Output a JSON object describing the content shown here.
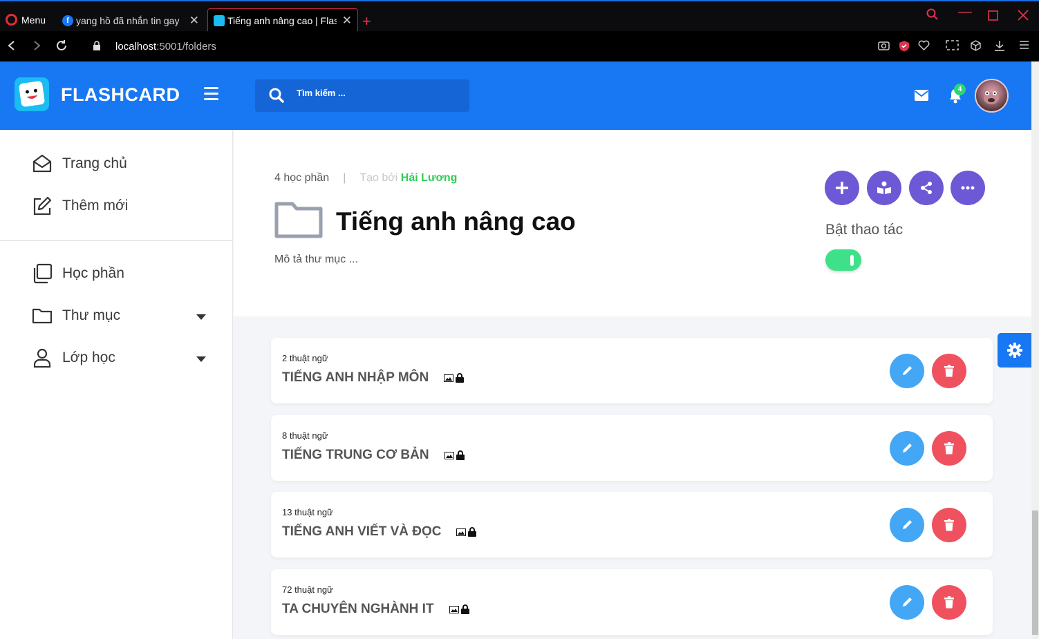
{
  "browser": {
    "menu_label": "Menu",
    "tabs": [
      {
        "title": "yang hồ đã nhắn tin gay"
      },
      {
        "title": "Tiếng anh nâng cao | Flashcard"
      }
    ],
    "url_host": "localhost",
    "url_rest": ":5001/folders"
  },
  "header": {
    "brand": "FLASHCARD",
    "search_placeholder": "Tìm kiếm ...",
    "notification_count": "4",
    "accent_color": "#1877f2"
  },
  "sidebar": {
    "items": [
      {
        "label": "Trang chủ",
        "icon": "home-icon"
      },
      {
        "label": "Thêm mới",
        "icon": "edit-icon"
      },
      {
        "label": "Học phần",
        "icon": "cards-icon"
      },
      {
        "label": "Thư mục",
        "icon": "folder-icon"
      },
      {
        "label": "Lớp học",
        "icon": "user-icon"
      }
    ]
  },
  "folder": {
    "count_label": "4 học phần",
    "separator": "|",
    "created_by_label": "Tạo bởi",
    "author": "Hải Lương",
    "title": "Tiếng anh nâng cao",
    "description": "Mô tả thư mục ...",
    "toggle_label": "Bật thao tác",
    "toggle_on": true
  },
  "sets": [
    {
      "terms": "2 thuật ngữ",
      "name": "TIẾNG ANH NHẬP MÔN"
    },
    {
      "terms": "8 thuật ngữ",
      "name": "TIẾNG TRUNG CƠ BẢN"
    },
    {
      "terms": "13 thuật ngữ",
      "name": "TIẾNG ANH VIẾT VÀ ĐỌC"
    },
    {
      "terms": "72 thuật ngữ",
      "name": "TA CHUYÊN NGHÀNH IT"
    }
  ],
  "colors": {
    "action_purple": "#6d59d6",
    "edit_blue": "#43a7f5",
    "delete_red": "#f0515f",
    "toggle_green": "#3fe08a",
    "author_green": "#2ecc55"
  }
}
